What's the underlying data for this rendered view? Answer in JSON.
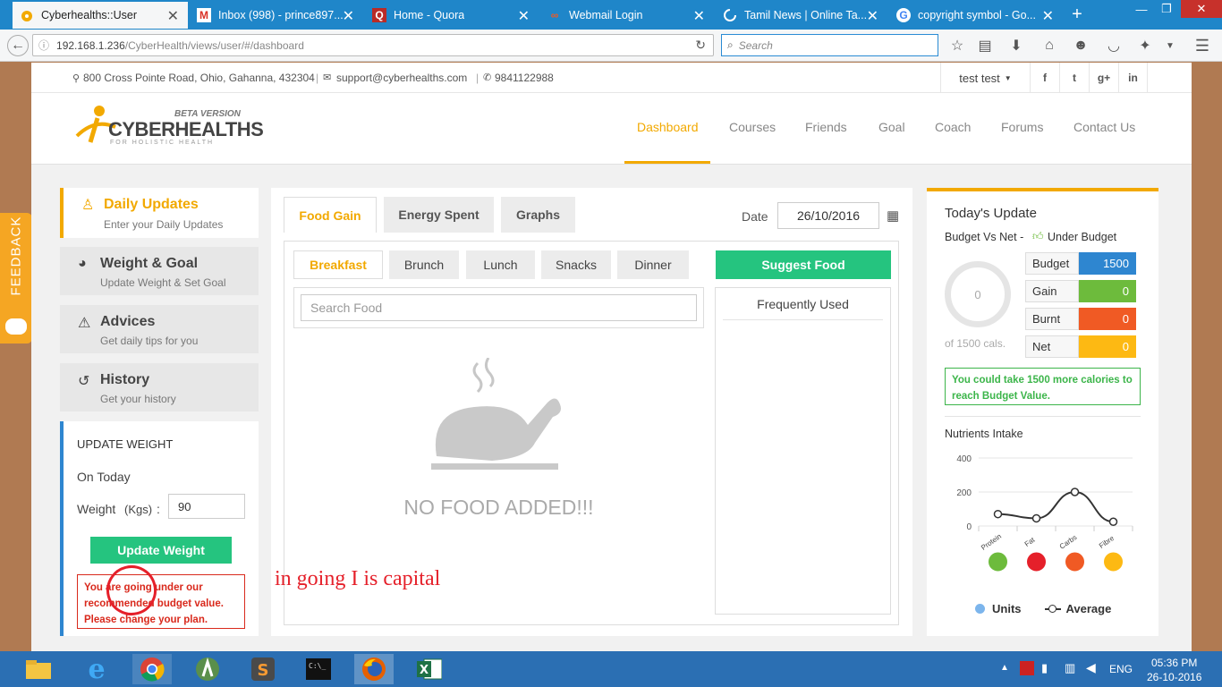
{
  "browser": {
    "tabs": [
      {
        "title": "Cyberhealths::User",
        "active": true
      },
      {
        "title": "Inbox (998) - prince897...",
        "active": false
      },
      {
        "title": "Home - Quora",
        "active": false
      },
      {
        "title": "Webmail Login",
        "active": false
      },
      {
        "title": "Tamil News | Online Ta...",
        "active": false
      },
      {
        "title": "copyright symbol - Go...",
        "active": false
      }
    ],
    "new_tab": "+",
    "url": {
      "host": "192.168.1.236",
      "path": "/CyberHealth/views/user/#/dashboard"
    },
    "search_placeholder": "Search"
  },
  "topbar": {
    "address": "800 Cross Pointe Road, Ohio, Gahanna, 432304",
    "email": "support@cyberhealths.com",
    "phone": "9841122988",
    "user_name": "test test",
    "social": [
      "f",
      "t",
      "g+",
      "in"
    ]
  },
  "header": {
    "logo_main": "CYBERHEALTHS",
    "logo_badge": "BETA VERSION",
    "logo_sub": "FOR HOLISTIC HEALTH",
    "nav": [
      "Dashboard",
      "Courses",
      "Friends",
      "Goal",
      "Coach",
      "Forums",
      "Contact Us"
    ]
  },
  "feedback_label": "FEEDBACK",
  "sidebar": {
    "items": [
      {
        "title": "Daily Updates",
        "sub": "Enter your Daily Updates"
      },
      {
        "title": "Weight & Goal",
        "sub": "Update Weight & Set Goal"
      },
      {
        "title": "Advices",
        "sub": "Get daily tips for you"
      },
      {
        "title": "History",
        "sub": "Get your history"
      }
    ],
    "update_weight": {
      "heading": "UPDATE WEIGHT",
      "on_today": "On Today",
      "weight_label": "Weight",
      "weight_unit": "(Kgs)",
      "colon": ":",
      "weight_value": "90",
      "button": "Update Weight",
      "warning": "You are going under our recommended budget value. Please change your plan."
    }
  },
  "main": {
    "tabs": [
      "Food Gain",
      "Energy Spent",
      "Graphs"
    ],
    "date_label": "Date",
    "date_value": "26/10/2016",
    "meals": [
      "Breakfast",
      "Brunch",
      "Lunch",
      "Snacks",
      "Dinner"
    ],
    "suggest_button": "Suggest Food",
    "search_placeholder": "Search Food",
    "empty_message": "NO FOOD ADDED!!!",
    "frequently_used": "Frequently Used"
  },
  "annotation": "in going I is capital",
  "right": {
    "title": "Today's Update",
    "budget_vs_net": "Budget Vs Net -",
    "under_budget": "Under Budget",
    "ring_value": "0",
    "ring_caption": "of 1500 cals.",
    "rows": [
      {
        "label": "Budget",
        "value": "1500",
        "color": "#2e86d0"
      },
      {
        "label": "Gain",
        "value": "0",
        "color": "#6dbb3c"
      },
      {
        "label": "Burnt",
        "value": "0",
        "color": "#f05a24"
      },
      {
        "label": "Net",
        "value": "0",
        "color": "#fdb913"
      }
    ],
    "message": "You could take 1500 more calories to reach Budget Value.",
    "nutrients_title": "Nutrients Intake",
    "legend": [
      "Units",
      "Average"
    ]
  },
  "chart_data": {
    "type": "line",
    "categories": [
      "Protein",
      "Fat",
      "Carbs",
      "Fibre"
    ],
    "series": [
      {
        "name": "Units",
        "values": [
          0,
          0,
          0,
          0
        ]
      },
      {
        "name": "Average",
        "values": [
          70,
          45,
          200,
          25
        ]
      }
    ],
    "yticks": [
      0,
      200,
      400
    ],
    "ylim": [
      0,
      400
    ],
    "legend": "bottom",
    "colors": {
      "Units": "#7cb5ec",
      "Average": "#333333"
    }
  },
  "taskbar": {
    "language": "ENG",
    "time": "05:36 PM",
    "date": "26-10-2016"
  }
}
